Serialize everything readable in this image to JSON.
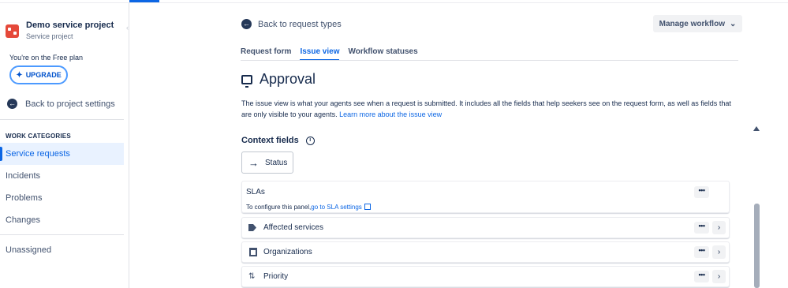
{
  "project": {
    "name": "Demo service project",
    "type": "Service project",
    "plan": "You're on the Free plan",
    "upgrade_label": "UPGRADE"
  },
  "sidebar": {
    "back_label": "Back to project settings",
    "category_heading": "WORK CATEGORIES",
    "items": [
      {
        "label": "Service requests",
        "active": true
      },
      {
        "label": "Incidents"
      },
      {
        "label": "Problems"
      },
      {
        "label": "Changes"
      }
    ],
    "unassigned_label": "Unassigned"
  },
  "header": {
    "back_label": "Back to request types",
    "manage_workflow_label": "Manage workflow",
    "tabs": [
      {
        "label": "Request form"
      },
      {
        "label": "Issue view",
        "active": true
      },
      {
        "label": "Workflow statuses"
      }
    ]
  },
  "main": {
    "title": "Approval",
    "description": "The issue view is what your agents see when a request is submitted. It includes all the fields that help seekers see on the request form, as well as fields that are only visible to your agents.",
    "learn_more_link": "Learn more about the issue view",
    "context_heading": "Context fields",
    "status_button": "Status",
    "sla": {
      "title": "SLAs",
      "note_prefix": "To configure this panel,",
      "note_link": "go to SLA settings"
    },
    "fields": [
      {
        "label": "Affected services",
        "icon": "tag-icon"
      },
      {
        "label": "Organizations",
        "icon": "organization-icon"
      },
      {
        "label": "Priority",
        "icon": "priority-icon"
      }
    ]
  },
  "colors": {
    "accent": "#0c66e4",
    "project_logo": "#e5493a"
  }
}
